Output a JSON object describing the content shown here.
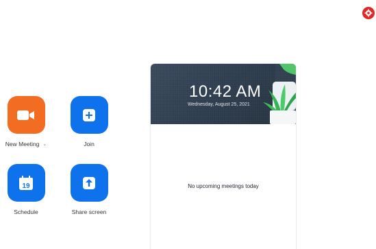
{
  "colors": {
    "new_meeting_tile": "#f26d21",
    "tile_blue": "#0e72ed",
    "settings_badge": "#e02828",
    "header_background": "#2f3e50"
  },
  "toolbar": {
    "settings_icon": "gear-icon"
  },
  "actions": [
    {
      "label": "New Meeting",
      "icon": "video-camera-icon",
      "has_dropdown": true
    },
    {
      "label": "Join",
      "icon": "plus-icon"
    },
    {
      "label": "Schedule",
      "icon": "calendar-icon",
      "icon_text": "19"
    },
    {
      "label": "Share screen",
      "icon": "arrow-up-icon"
    }
  ],
  "panel": {
    "time": "10:42 AM",
    "date": "Wednesday, August 25, 2021",
    "empty_message": "No upcoming meetings today"
  }
}
